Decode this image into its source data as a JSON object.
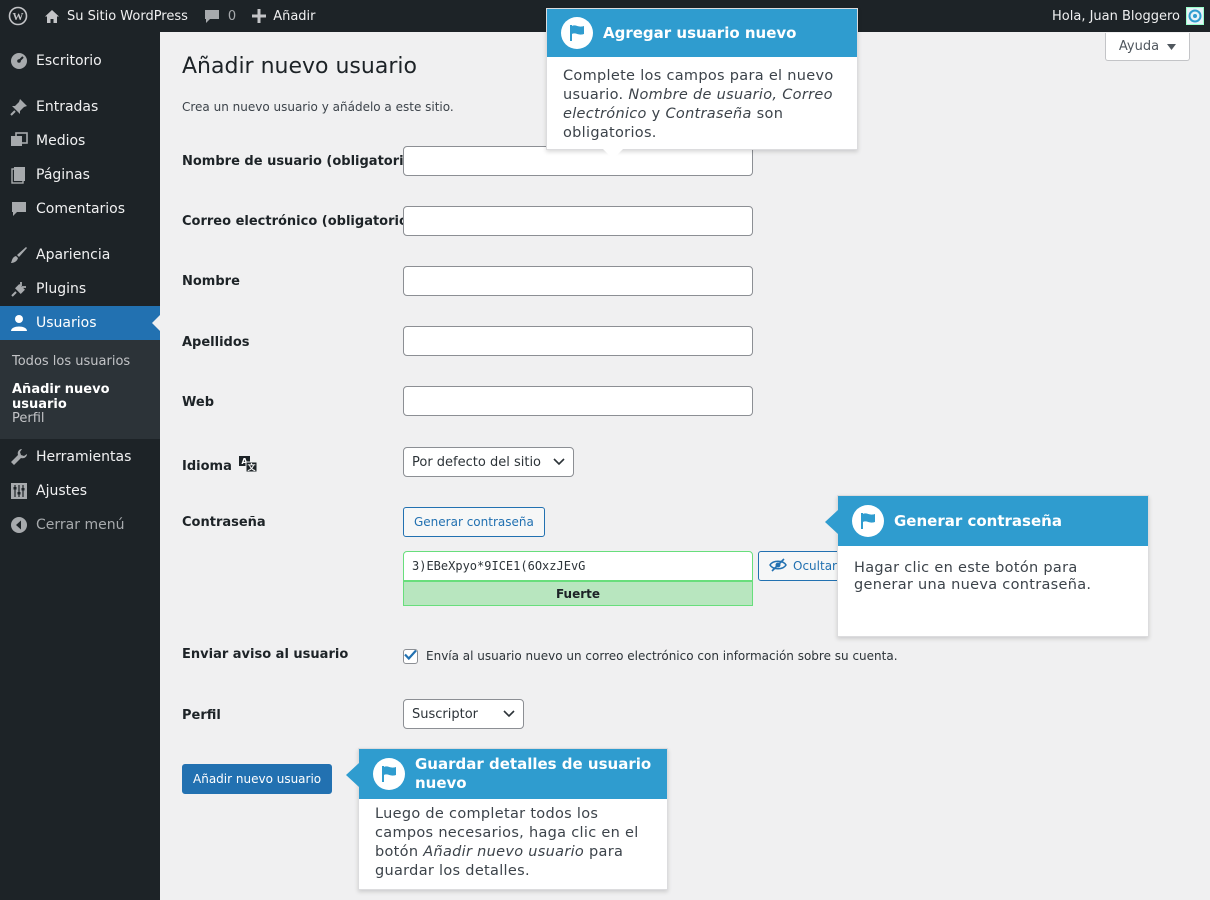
{
  "adminbar": {
    "site_name": "Su Sitio WordPress",
    "comments_count": "0",
    "new_label": "Añadir",
    "greeting": "Hola, Juan Bloggero"
  },
  "sidebar": {
    "items": [
      {
        "label": "Escritorio",
        "icon": "dashboard-icon"
      },
      {
        "label": "Entradas",
        "icon": "pin-icon"
      },
      {
        "label": "Medios",
        "icon": "media-icon"
      },
      {
        "label": "Páginas",
        "icon": "page-icon"
      },
      {
        "label": "Comentarios",
        "icon": "comment-icon"
      },
      {
        "label": "Apariencia",
        "icon": "brush-icon"
      },
      {
        "label": "Plugins",
        "icon": "plug-icon"
      },
      {
        "label": "Usuarios",
        "icon": "user-icon"
      },
      {
        "label": "Herramientas",
        "icon": "wrench-icon"
      },
      {
        "label": "Ajustes",
        "icon": "settings-icon"
      },
      {
        "label": "Cerrar menú",
        "icon": "collapse-icon"
      }
    ],
    "submenu": [
      "Todos los usuarios",
      "Añadir nuevo usuario",
      "Perfil"
    ]
  },
  "help_label": "Ayuda",
  "page": {
    "title": "Añadir nuevo usuario",
    "description": "Crea un nuevo usuario y añádelo a este sitio."
  },
  "form": {
    "username_label": "Nombre de usuario (obligatorio)",
    "email_label": "Correo electrónico (obligatorio)",
    "firstname_label": "Nombre",
    "lastname_label": "Apellidos",
    "website_label": "Web",
    "language_label": "Idioma",
    "language_value": "Por defecto del sitio",
    "password_label": "Contraseña",
    "generate_password_label": "Generar contraseña",
    "password_value": "3)EBeXpyo*9ICE1(6OxzJEvG",
    "hide_label": "Ocultar",
    "strength_label": "Fuerte",
    "notify_label": "Enviar aviso al usuario",
    "notify_text": "Envía al usuario nuevo un correo electrónico con información sobre su cuenta.",
    "role_label": "Perfil",
    "role_value": "Suscriptor",
    "submit_label": "Añadir nuevo usuario"
  },
  "pointers": {
    "p1_title": "Agregar usuario nuevo",
    "p1_text_a": "Complete los campos para el nuevo usuario.",
    "p1_em1": "Nombre de usuario,",
    "p1_em2": "Correo electrónico",
    "p1_text_b": "y",
    "p1_em3": "Contraseña",
    "p1_text_c": "son obligatorios.",
    "p2_title": "Generar contraseña",
    "p2_text": "Hagar clic en este botón para generar una nueva contraseña.",
    "p3_title": "Guardar detalles de usuario nuevo",
    "p3_text_a": "Luego de completar todos los campos necesarios, haga clic en el botón",
    "p3_em": "Añadir nuevo usuario",
    "p3_text_b": "para guardar los detalles."
  },
  "colors": {
    "accent": "#2271b1",
    "pointer_header": "#2f9ccf",
    "sidebar_bg": "#1d2327",
    "strength_bg": "#b8e6bf"
  }
}
